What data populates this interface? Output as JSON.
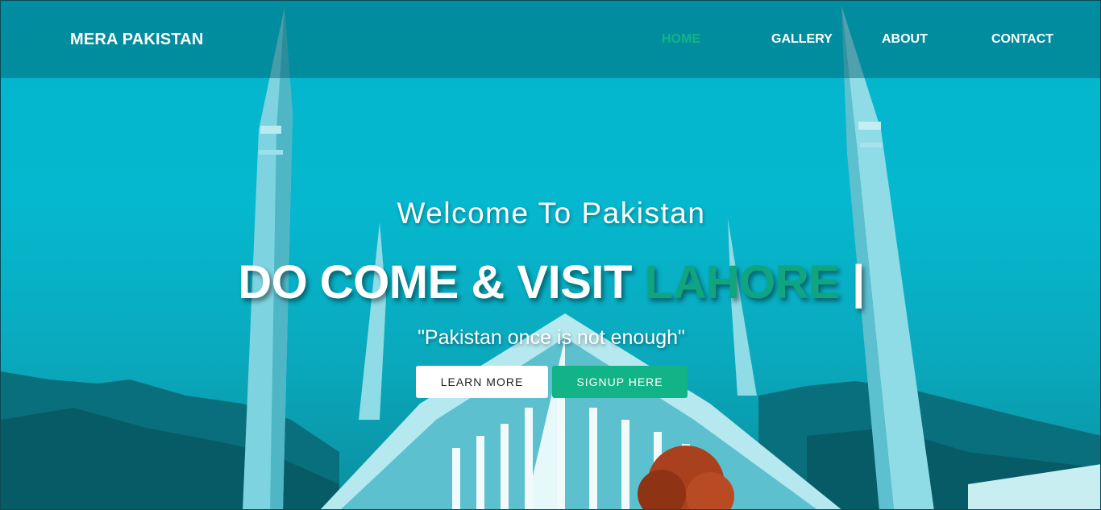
{
  "navbar": {
    "brand": "MERA PAKISTAN",
    "items": [
      {
        "label": "HOME",
        "active": true
      },
      {
        "label": "GALLERY",
        "active": false
      },
      {
        "label": "ABOUT",
        "active": false
      },
      {
        "label": "CONTACT",
        "active": false
      }
    ]
  },
  "hero": {
    "welcome": "Welcome To Pakistan",
    "headline_prefix": "DO COME & VISIT ",
    "headline_city": "LAHORE",
    "headline_cursor": " |",
    "tagline": "\"Pakistan once is not enough\"",
    "learn_more_label": "LEARN MORE",
    "signup_label": "SIGNUP HERE"
  },
  "colors": {
    "accent": "#12b386",
    "overlay": "#03b5cc",
    "navbar": "#005a69"
  },
  "background_image": "mosque-with-minarets-photo"
}
